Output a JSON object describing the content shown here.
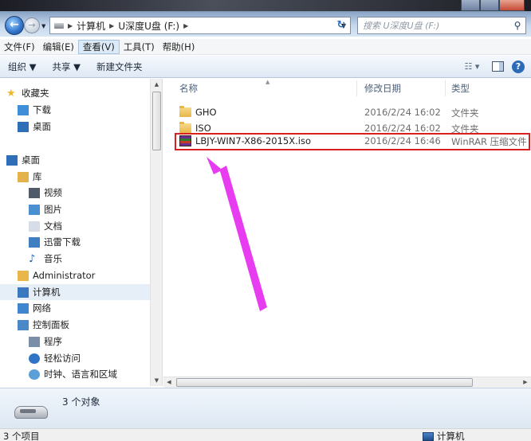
{
  "address": {
    "crumbs": [
      "计算机",
      "U深度U盘 (F:)"
    ],
    "search_placeholder": "搜索 U深度U盘 (F:)"
  },
  "menu": [
    "文件(F)",
    "编辑(E)",
    "查看(V)",
    "工具(T)",
    "帮助(H)"
  ],
  "menu_active_index": 2,
  "toolbar": {
    "organize": "组织 ▼",
    "share": "共享 ▼",
    "new_folder": "新建文件夹"
  },
  "sidebar": [
    {
      "label": "收藏夹",
      "icon": "star-icon",
      "indent": 0
    },
    {
      "label": "下载",
      "icon": "download-folder-icon",
      "indent": 1
    },
    {
      "label": "桌面",
      "icon": "desktop-icon",
      "indent": 1
    },
    {
      "label": "桌面",
      "icon": "desktop-icon",
      "indent": 0
    },
    {
      "label": "库",
      "icon": "library-icon",
      "indent": 1
    },
    {
      "label": "视频",
      "icon": "video-icon",
      "indent": 2
    },
    {
      "label": "图片",
      "icon": "picture-icon",
      "indent": 2
    },
    {
      "label": "文档",
      "icon": "document-icon",
      "indent": 2
    },
    {
      "label": "迅雷下载",
      "icon": "thunder-download-icon",
      "indent": 2
    },
    {
      "label": "音乐",
      "icon": "music-icon",
      "indent": 2
    },
    {
      "label": "Administrator",
      "icon": "user-folder-icon",
      "indent": 1
    },
    {
      "label": "计算机",
      "icon": "computer-icon",
      "indent": 1,
      "selected": true
    },
    {
      "label": "网络",
      "icon": "network-icon",
      "indent": 1
    },
    {
      "label": "控制面板",
      "icon": "control-panel-icon",
      "indent": 1
    },
    {
      "label": "程序",
      "icon": "programs-icon",
      "indent": 2
    },
    {
      "label": "轻松访问",
      "icon": "accessibility-icon",
      "indent": 2
    },
    {
      "label": "时钟、语言和区域",
      "icon": "clock-icon",
      "indent": 2
    }
  ],
  "columns": {
    "name": "名称",
    "date": "修改日期",
    "type": "类型"
  },
  "files": [
    {
      "name": "GHO",
      "date": "2016/2/24 16:02",
      "type": "文件夹",
      "icon": "folder-icon"
    },
    {
      "name": "ISO",
      "date": "2016/2/24 16:02",
      "type": "文件夹",
      "icon": "folder-icon"
    },
    {
      "name": "LBJY-WIN7-X86-2015X.iso",
      "date": "2016/2/24 16:46",
      "type": "WinRAR 压缩文件",
      "icon": "winrar-icon",
      "highlighted": true
    }
  ],
  "details": {
    "count": "3 个对象"
  },
  "status": {
    "left": "3 个项目",
    "right": "计算机"
  },
  "colors": {
    "highlight_box": "#d92020",
    "annotation_arrow": "#e83cf0",
    "selection": "#e6eef8"
  }
}
